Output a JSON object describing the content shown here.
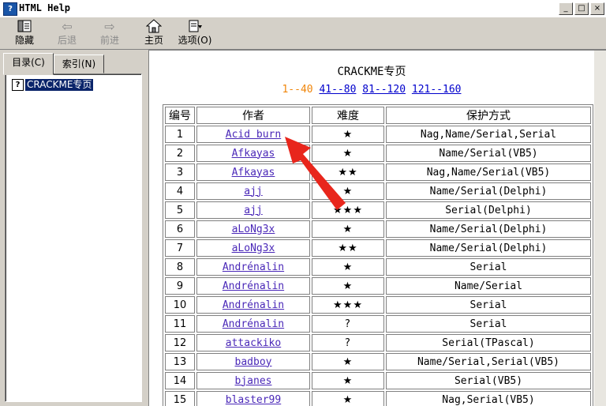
{
  "window": {
    "title": "HTML Help",
    "app_icon": "help-book-icon",
    "minimize": "_",
    "maximize": "□",
    "close": "×"
  },
  "toolbar": {
    "hide": {
      "label": "隐藏",
      "icon": "hide-pane-icon"
    },
    "back": {
      "label": "后退",
      "icon": "back-arrow-icon"
    },
    "forward": {
      "label": "前进",
      "icon": "forward-arrow-icon"
    },
    "home": {
      "label": "主页",
      "icon": "home-icon"
    },
    "options": {
      "label": "选项(O)",
      "icon": "options-icon"
    }
  },
  "left": {
    "tabs": [
      {
        "label": "目录(C)"
      },
      {
        "label": "索引(N)"
      }
    ],
    "tree": {
      "item_label": "CRACKME专页",
      "item_icon": "help-topic-icon"
    }
  },
  "page": {
    "title": "CRACKME专页",
    "nav": [
      {
        "label": "1--40"
      },
      {
        "label": "41--80"
      },
      {
        "label": "81--120"
      },
      {
        "label": "121--160"
      }
    ],
    "table": {
      "headers": [
        "编号",
        "作者",
        "难度",
        "保护方式"
      ],
      "rows": [
        {
          "no": "1",
          "author": "Acid burn",
          "difficulty": "★",
          "protection": "Nag,Name/Serial,Serial"
        },
        {
          "no": "2",
          "author": "Afkayas",
          "difficulty": "★",
          "protection": "Name/Serial(VB5)"
        },
        {
          "no": "3",
          "author": "Afkayas",
          "difficulty": "★★",
          "protection": "Nag,Name/Serial(VB5)"
        },
        {
          "no": "4",
          "author": "ajj",
          "difficulty": "★",
          "protection": "Name/Serial(Delphi)"
        },
        {
          "no": "5",
          "author": "ajj",
          "difficulty": "★★★",
          "protection": "Serial(Delphi)"
        },
        {
          "no": "6",
          "author": "aLoNg3x",
          "difficulty": "★",
          "protection": "Name/Serial(Delphi)"
        },
        {
          "no": "7",
          "author": "aLoNg3x",
          "difficulty": "★★",
          "protection": "Name/Serial(Delphi)"
        },
        {
          "no": "8",
          "author": "Andrénalin",
          "difficulty": "★",
          "protection": "Serial"
        },
        {
          "no": "9",
          "author": "Andrénalin",
          "difficulty": "★",
          "protection": "Name/Serial"
        },
        {
          "no": "10",
          "author": "Andrénalin",
          "difficulty": "★★★",
          "protection": "Serial"
        },
        {
          "no": "11",
          "author": "Andrénalin",
          "difficulty": "?",
          "protection": "Serial"
        },
        {
          "no": "12",
          "author": "attackiko",
          "difficulty": "?",
          "protection": "Serial(TPascal)"
        },
        {
          "no": "13",
          "author": "badboy",
          "difficulty": "★",
          "protection": "Name/Serial,Serial(VB5)"
        },
        {
          "no": "14",
          "author": "bjanes",
          "difficulty": "★",
          "protection": "Serial(VB5)"
        },
        {
          "no": "15",
          "author": "blaster99",
          "difficulty": "★",
          "protection": "Nag,Serial(VB5)"
        }
      ]
    }
  },
  "annotation": {
    "color": "#e8261c",
    "icon": "red-arrow-annotation"
  }
}
